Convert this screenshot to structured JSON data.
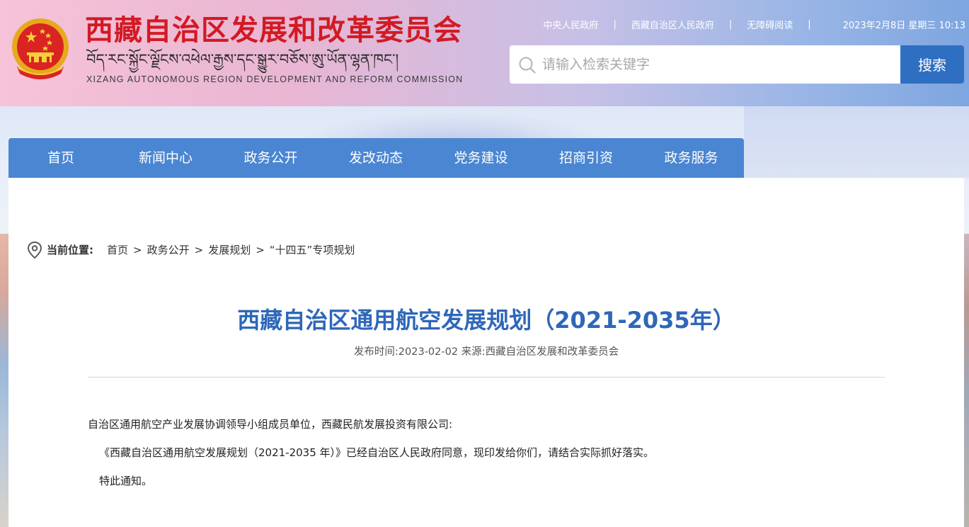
{
  "header": {
    "title_cn": "西藏自治区发展和改革委员会",
    "title_tibetan": "བོད་རང་སྐྱོང་ལྗོངས་འཕེལ་རྒྱས་དང་སྒྱུར་བཅོས་ཨུ་ཡོན་ལྷན་ཁང་།",
    "title_en": "XIZANG AUTONOMOUS REGION DEVELOPMENT AND REFORM COMMISSION",
    "emblem_icon": "national-emblem-icon"
  },
  "toplinks": {
    "central_gov": "中央人民政府",
    "region_gov": "西藏自治区人民政府",
    "accessibility": "无障碍阅读",
    "separator": "|",
    "datetime": "2023年2月8日 星期三 10:13"
  },
  "search": {
    "placeholder": "请输入检索关键字",
    "value": "",
    "button_label": "搜索",
    "icon": "search-icon"
  },
  "nav": {
    "items": [
      {
        "label": "首页"
      },
      {
        "label": "新闻中心"
      },
      {
        "label": "政务公开"
      },
      {
        "label": "发改动态"
      },
      {
        "label": "党务建设"
      },
      {
        "label": "招商引资"
      },
      {
        "label": "政务服务"
      }
    ]
  },
  "breadcrumb": {
    "icon": "location-pin-icon",
    "label": "当前位置:",
    "separator": ">",
    "items": [
      {
        "label": "首页"
      },
      {
        "label": "政务公开"
      },
      {
        "label": "发展规划"
      },
      {
        "label": "“十四五”专项规划"
      }
    ]
  },
  "article": {
    "title": "西藏自治区通用航空发展规划（2021-2035年）",
    "meta_time_label": "发布时间:",
    "meta_time": "2023-02-02",
    "meta_source_label": "来源:",
    "meta_source": "西藏自治区发展和改革委员会",
    "paragraphs": [
      "自治区通用航空产业发展协调领导小组成员单位，西藏民航发展投资有限公司:",
      "《西藏自治区通用航空发展规划（2021-2035 年）》已经自治区人民政府同意，现印发给你们，请结合实际抓好落实。",
      "特此通知。"
    ]
  },
  "colors": {
    "title_red": "#d21a24",
    "nav_blue": "#4a86d2",
    "search_button_blue": "#2f6fc2",
    "article_title_blue": "#2e67b8"
  }
}
